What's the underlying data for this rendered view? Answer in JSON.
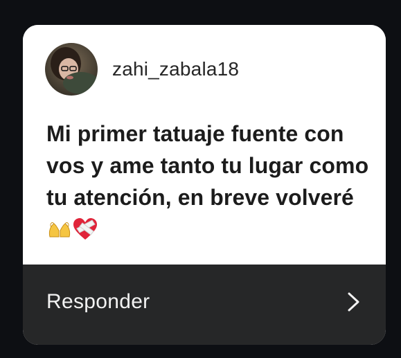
{
  "prompt_card": {
    "username": "zahi_zabala18",
    "message_text": "Mi primer tatuaje fuente con vos y ame tanto tu lugar como tu atención, en breve volveré",
    "message_emojis": [
      "hands-heart-emoji",
      "mending-heart-emoji"
    ],
    "reply_label": "Responder",
    "colors": {
      "background": "#0d0f13",
      "card": "#ffffff",
      "footer": "#262728",
      "text_dark": "#1c1c1c",
      "text_light": "#f2f2f2"
    }
  }
}
